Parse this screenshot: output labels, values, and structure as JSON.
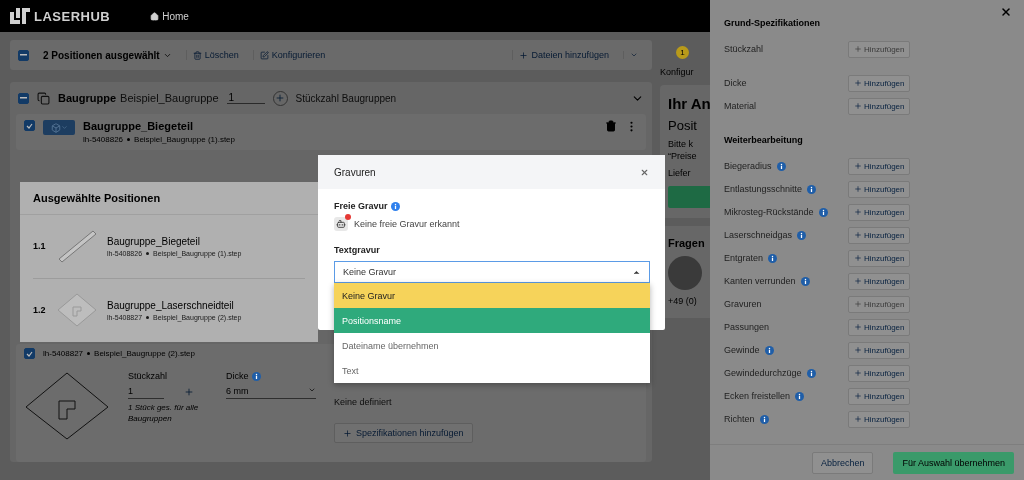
{
  "topbar": {
    "logo": "LASERHUB",
    "home": "Home"
  },
  "toolbar": {
    "indeterminate": true,
    "selection": "2 Positionen ausgewählt",
    "delete": "Löschen",
    "configure": "Konfigurieren",
    "add_files": "Dateien hinzufügen"
  },
  "group": {
    "indeterminate": true,
    "label": "Baugruppe",
    "name": "Beispiel_Baugruppe",
    "quantity": "1",
    "add_quantity": "Stückzahl Baugruppen"
  },
  "parts": [
    {
      "checked": true,
      "name": "Baugruppe_Biegeteil",
      "id": "lh-5408826",
      "file": "Beispiel_Baugruppe (1).step"
    },
    {
      "checked": true,
      "id": "lh-5408827",
      "file": "Beispiel_Baugruppe (2).step",
      "quantity_label": "Stückzahl",
      "quantity": "1",
      "quantity_note": "1 Stück ges. für alle Baugruppen",
      "thickness_label": "Dicke",
      "thickness": "6 mm",
      "specs_empty": "Keine definiert",
      "add_specs": "Spezifikationen hinzufügen"
    }
  ],
  "summary": {
    "step": "1",
    "step_label": "Konfigur",
    "title": "Ihr An",
    "position_title": "Posit",
    "note_lines": [
      "Bitte k",
      "“Preise"
    ],
    "delivery": "Liefer",
    "questions": "Fragen",
    "phone": "+49 (0)"
  },
  "selected_positions": {
    "title": "Ausgewählte Positionen",
    "items": [
      {
        "index": "1.1",
        "kind": "bar",
        "name": "Baugruppe_Biegeteil",
        "id": "lh-5408826",
        "file": "Beispiel_Baugruppe (1).step"
      },
      {
        "index": "1.2",
        "kind": "plate",
        "name": "Baugruppe_Laserschneidteil",
        "id": "lh-5408827",
        "file": "Beispiel_Baugruppe (2).step"
      }
    ]
  },
  "modal": {
    "title": "Gravuren",
    "free_label": "Freie Gravur",
    "free_status": "Keine freie Gravur erkannt",
    "text_label": "Textgravur",
    "value": "Keine Gravur",
    "expanded": true,
    "options": [
      {
        "label": "Keine Gravur",
        "selected": true,
        "hovered": false
      },
      {
        "label": "Positionsname",
        "selected": false,
        "hovered": true
      },
      {
        "label": "Dateiname übernehmen",
        "selected": false,
        "hovered": false
      },
      {
        "label": "Text",
        "selected": false,
        "hovered": false
      }
    ]
  },
  "drawer": {
    "sections": [
      {
        "title": "Grund-Spezifikationen",
        "groups": [
          [
            {
              "label": "Stückzahl",
              "info": false,
              "button": "Hinzufügen",
              "disabled": true
            }
          ],
          [
            {
              "label": "Dicke",
              "info": false,
              "button": "Hinzufügen",
              "disabled": false
            },
            {
              "label": "Material",
              "info": false,
              "button": "Hinzufügen",
              "disabled": false
            }
          ]
        ]
      },
      {
        "title": "Weiterbearbeitung",
        "groups": [
          [
            {
              "label": "Biegeradius",
              "info": true,
              "button": "Hinzufügen",
              "disabled": false
            },
            {
              "label": "Entlastungsschnitte",
              "info": true,
              "button": "Hinzufügen",
              "disabled": false
            },
            {
              "label": "Mikrosteg-Rückstände",
              "info": true,
              "button": "Hinzufügen",
              "disabled": false
            },
            {
              "label": "Laserschneidgas",
              "info": true,
              "button": "Hinzufügen",
              "disabled": false
            },
            {
              "label": "Entgraten",
              "info": true,
              "button": "Hinzufügen",
              "disabled": false
            },
            {
              "label": "Kanten verrunden",
              "info": true,
              "button": "Hinzufügen",
              "disabled": false
            },
            {
              "label": "Gravuren",
              "info": false,
              "button": "Hinzufügen",
              "disabled": true
            },
            {
              "label": "Passungen",
              "info": false,
              "button": "Hinzufügen",
              "disabled": false
            },
            {
              "label": "Gewinde",
              "info": true,
              "button": "Hinzufügen",
              "disabled": false
            },
            {
              "label": "Gewindedurchzüge",
              "info": true,
              "button": "Hinzufügen",
              "disabled": false
            },
            {
              "label": "Ecken freistellen",
              "info": true,
              "button": "Hinzufügen",
              "disabled": false
            },
            {
              "label": "Richten",
              "info": true,
              "button": "Hinzufügen",
              "disabled": false
            }
          ]
        ]
      }
    ],
    "cancel": "Abbrechen",
    "apply": "Für Auswahl übernehmen"
  }
}
